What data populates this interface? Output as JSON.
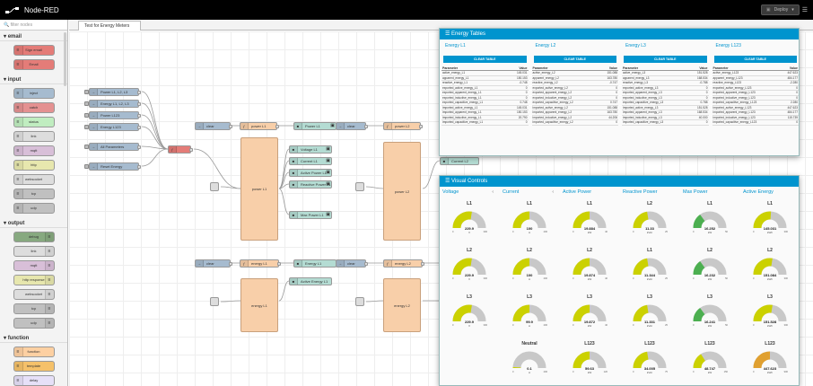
{
  "app": {
    "title": "Node-RED",
    "deploy_label": "Deploy"
  },
  "palette": {
    "filter_placeholder": "filter nodes",
    "categories": [
      {
        "name": "email",
        "nodes": [
          {
            "label": "Sign email",
            "color": "#e47c78"
          },
          {
            "label": "Email",
            "color": "#e47c78"
          }
        ]
      },
      {
        "name": "input",
        "nodes": [
          {
            "label": "inject",
            "color": "#a6bbcf"
          },
          {
            "label": "catch",
            "color": "#e49191"
          },
          {
            "label": "status",
            "color": "#c0edc0"
          },
          {
            "label": "link",
            "color": "#dddddd"
          },
          {
            "label": "mqtt",
            "color": "#d8bfd8"
          },
          {
            "label": "http",
            "color": "#e7e7ae"
          },
          {
            "label": "websocket",
            "color": "#dddddd"
          },
          {
            "label": "tcp",
            "color": "#c0c0c0"
          },
          {
            "label": "udp",
            "color": "#c0c0c0"
          }
        ]
      },
      {
        "name": "output",
        "nodes": [
          {
            "label": "debug",
            "color": "#87a980"
          },
          {
            "label": "link",
            "color": "#dddddd"
          },
          {
            "label": "mqtt",
            "color": "#d8bfd8"
          },
          {
            "label": "http response",
            "color": "#e7e7ae"
          },
          {
            "label": "websocket",
            "color": "#dddddd"
          },
          {
            "label": "tcp",
            "color": "#c0c0c0"
          },
          {
            "label": "udp",
            "color": "#c0c0c0"
          }
        ]
      },
      {
        "name": "function",
        "nodes": [
          {
            "label": "function",
            "color": "#fdd0a2"
          },
          {
            "label": "template",
            "color": "#f5c16a"
          },
          {
            "label": "delay",
            "color": "#e6e0f8"
          },
          {
            "label": "trigger",
            "color": "#e6e0f8"
          }
        ]
      }
    ]
  },
  "workspace": {
    "tab": "Test for Energy Meters"
  },
  "flow": {
    "injects": [
      "Power L1, L2, L3",
      "Energy L1, L2, L3",
      "Power L123",
      "Energy L123",
      "All Parameters",
      "Reset Energy"
    ],
    "clear": "clear",
    "power_l1": "power L1",
    "power_l2": "power L2",
    "energy_l1": "energy L1",
    "energy_l2": "energy L2",
    "outputs_top": [
      "Power L1",
      "Voltage L1",
      "Current L1",
      "Active Power L1",
      "Reactive Power L1",
      "Max Power L1"
    ],
    "outputs_bottom": [
      "Energy L1",
      "Active Energy L1"
    ],
    "current_l2": "Current L2",
    "current_l3": "Current L3",
    "active_power_l123": "Active Power L123"
  },
  "energy_tables": {
    "title": "Energy Tables",
    "clear_label": "CLEAR TABLE",
    "col_param": "Parameter",
    "col_value": "Value",
    "tables": [
      {
        "name": "Energy L1",
        "rows": [
          [
            "active_energy_L1",
            "145.031"
          ],
          [
            "apparent_energy_L1",
            "150.153"
          ],
          [
            "reactive_energy_L1",
            "-0.748"
          ],
          [
            "exported_active_energy_L1",
            "0"
          ],
          [
            "exported_apparent_energy_L1",
            "0"
          ],
          [
            "exported_inductive_energy_L1",
            "0"
          ],
          [
            "exported_capacitive_energy_L1",
            "0.748"
          ],
          [
            "imported_active_energy_L1",
            "145.031"
          ],
          [
            "imported_apparent_energy_L1",
            "150.153"
          ],
          [
            "imported_inductive_energy_L1",
            "20.790"
          ],
          [
            "imported_capacitive_energy_L1",
            "0"
          ]
        ]
      },
      {
        "name": "Energy L2",
        "rows": [
          [
            "active_energy_L2",
            "151.088"
          ],
          [
            "apparent_energy_L2",
            "163.780"
          ],
          [
            "reactive_energy_L2",
            "-0.747"
          ],
          [
            "exported_active_energy_L2",
            "0"
          ],
          [
            "exported_apparent_energy_L2",
            "0"
          ],
          [
            "exported_inductive_energy_L2",
            "0"
          ],
          [
            "exported_capacitive_energy_L2",
            "0.747"
          ],
          [
            "imported_active_energy_L2",
            "151.088"
          ],
          [
            "imported_apparent_energy_L2",
            "163.780"
          ],
          [
            "imported_inductive_energy_L2",
            "44.206"
          ],
          [
            "imported_capacitive_energy_L2",
            "0"
          ]
        ]
      },
      {
        "name": "Energy L3",
        "rows": [
          [
            "active_energy_L3",
            "151.528"
          ],
          [
            "apparent_energy_L3",
            "168.534"
          ],
          [
            "reactive_energy_L3",
            "-0.788"
          ],
          [
            "exported_active_energy_L3",
            "0"
          ],
          [
            "exported_apparent_energy_L3",
            "0"
          ],
          [
            "exported_inductive_energy_L3",
            "0"
          ],
          [
            "exported_capacitive_energy_L3",
            "0.788"
          ],
          [
            "imported_active_energy_L3",
            "151.528"
          ],
          [
            "imported_apparent_energy_L3",
            "168.534"
          ],
          [
            "imported_inductive_energy_L3",
            "40.000"
          ],
          [
            "imported_capacitive_energy_L3",
            "0"
          ]
        ]
      },
      {
        "name": "Energy L123",
        "rows": [
          [
            "active_energy_L123",
            "447.623"
          ],
          [
            "apparent_energy_L123",
            "484.177"
          ],
          [
            "reactive_energy_L123",
            "-2.280"
          ],
          [
            "exported_active_energy_L123",
            "0"
          ],
          [
            "exported_apparent_energy_L123",
            "0"
          ],
          [
            "exported_inductive_energy_L123",
            "0"
          ],
          [
            "exported_capacitive_energy_L123",
            "2.280"
          ],
          [
            "imported_active_energy_L123",
            "447.623"
          ],
          [
            "imported_apparent_energy_L123",
            "484.177"
          ],
          [
            "imported_inductive_energy_L123",
            "115.739"
          ],
          [
            "imported_capacitive_energy_L123",
            "0"
          ]
        ]
      }
    ]
  },
  "visual_controls": {
    "title": "Visual Controls",
    "columns": [
      "Voltage",
      "Current",
      "Active Power",
      "Reactive Power",
      "Max Power",
      "Active Energy"
    ],
    "gauges": [
      [
        {
          "label": "L1",
          "value": "229.9",
          "unit": "V",
          "fill": 0.55,
          "color": "#cbd100",
          "min": "0",
          "max": "300"
        },
        {
          "label": "L1",
          "value": "100",
          "unit": "A",
          "fill": 0.5,
          "color": "#cbd100",
          "min": "0",
          "max": "200"
        },
        {
          "label": "L1",
          "value": "19.884",
          "unit": "kW",
          "fill": 0.5,
          "color": "#cbd100",
          "min": "0",
          "max": "40"
        },
        {
          "label": "L2",
          "value": "11.33",
          "unit": "kVAr",
          "fill": 0.45,
          "color": "#cbd100",
          "min": "0",
          "max": "25"
        },
        {
          "label": "L1",
          "value": "16.252",
          "unit": "kW",
          "fill": 0.3,
          "color": "#4caf50",
          "min": "0",
          "max": "50"
        },
        {
          "label": "L1",
          "value": "145.031",
          "unit": "kWh",
          "fill": 0.52,
          "color": "#cbd100",
          "min": "0",
          "max": "300"
        }
      ],
      [
        {
          "label": "L2",
          "value": "229.9",
          "unit": "V",
          "fill": 0.55,
          "color": "#cbd100",
          "min": "0",
          "max": "300"
        },
        {
          "label": "L2",
          "value": "100",
          "unit": "A",
          "fill": 0.5,
          "color": "#cbd100",
          "min": "0",
          "max": "200"
        },
        {
          "label": "L2",
          "value": "19.874",
          "unit": "kW",
          "fill": 0.5,
          "color": "#cbd100",
          "min": "0",
          "max": "40"
        },
        {
          "label": "L1",
          "value": "11.344",
          "unit": "kVAr",
          "fill": 0.45,
          "color": "#cbd100",
          "min": "0",
          "max": "25"
        },
        {
          "label": "L2",
          "value": "16.232",
          "unit": "kW",
          "fill": 0.3,
          "color": "#4caf50",
          "min": "0",
          "max": "50"
        },
        {
          "label": "L2",
          "value": "151.084",
          "unit": "kWh",
          "fill": 0.55,
          "color": "#cbd100",
          "min": "0",
          "max": "300"
        }
      ],
      [
        {
          "label": "L3",
          "value": "229.9",
          "unit": "V",
          "fill": 0.55,
          "color": "#cbd100",
          "min": "0",
          "max": "300"
        },
        {
          "label": "L3",
          "value": "99.9",
          "unit": "A",
          "fill": 0.5,
          "color": "#cbd100",
          "min": "0",
          "max": "200"
        },
        {
          "label": "L3",
          "value": "19.872",
          "unit": "kW",
          "fill": 0.5,
          "color": "#cbd100",
          "min": "0",
          "max": "40"
        },
        {
          "label": "L3",
          "value": "11.331",
          "unit": "kVAr",
          "fill": 0.45,
          "color": "#cbd100",
          "min": "0",
          "max": "25"
        },
        {
          "label": "L3",
          "value": "16.241",
          "unit": "kW",
          "fill": 0.3,
          "color": "#4caf50",
          "min": "0",
          "max": "50"
        },
        {
          "label": "L3",
          "value": "151.528",
          "unit": "kWh",
          "fill": 0.55,
          "color": "#cbd100",
          "min": "0",
          "max": "300"
        }
      ],
      [
        null,
        {
          "label": "Neutral",
          "value": "0.1",
          "unit": "A",
          "fill": 0.02,
          "color": "#cbd100",
          "min": "0",
          "max": "200"
        },
        {
          "label": "L123",
          "value": "59.63",
          "unit": "kW",
          "fill": 0.5,
          "color": "#cbd100",
          "min": "0",
          "max": "120"
        },
        {
          "label": "L123",
          "value": "34.005",
          "unit": "kVAr",
          "fill": 0.45,
          "color": "#cbd100",
          "min": "0",
          "max": "75"
        },
        {
          "label": "L123",
          "value": "48.747",
          "unit": "kW",
          "fill": 0.32,
          "color": "#cbd100",
          "min": "0",
          "max": "150"
        },
        {
          "label": "L123",
          "value": "447.623",
          "unit": "kWh",
          "fill": 0.5,
          "color": "#e0a030",
          "min": "0",
          "max": "900"
        }
      ]
    ]
  }
}
